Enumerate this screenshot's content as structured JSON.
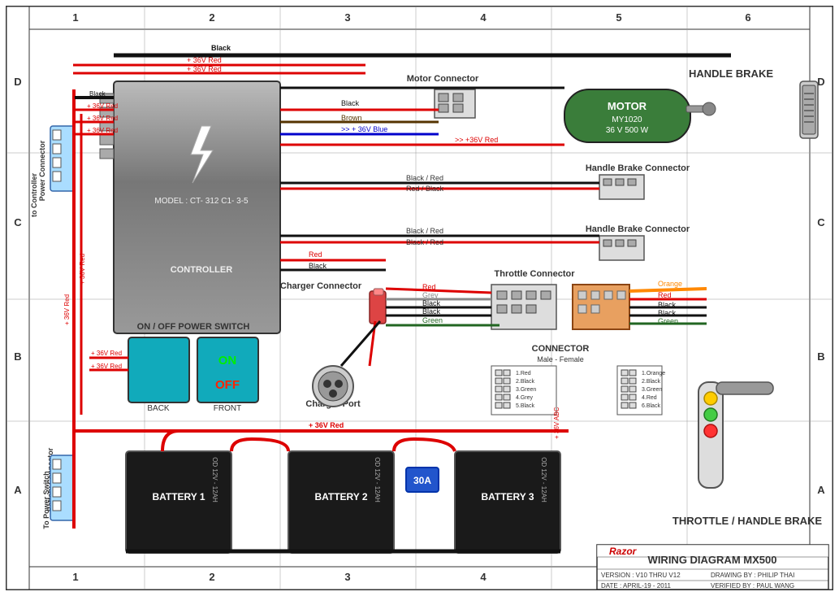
{
  "diagram": {
    "title": "WIRING DIAGRAM MX500",
    "version": "VERSION : V10 THRU V12",
    "drawing_by": "DRAWING BY : PHILIP THAI",
    "date": "DATE : APRIL-19 - 2011",
    "verified_by": "VERIFIED BY : PAUL WANG",
    "brand": "Razor",
    "col_labels": [
      "1",
      "2",
      "3",
      "4",
      "5",
      "6"
    ],
    "row_labels": [
      "D",
      "C",
      "B",
      "A"
    ],
    "components": {
      "motor": {
        "label": "MOTOR",
        "model": "MY1020",
        "spec": "36 V 500 W"
      },
      "controller": {
        "label": "CONTROLLER",
        "model": "MODEL : CT- 312 C1- 3-5"
      },
      "batteries": [
        {
          "label": "BATTERY 1",
          "spec": "OD 12V - 12AH"
        },
        {
          "label": "BATTERY 2",
          "spec": "OD 12V - 12AH"
        },
        {
          "label": "BATTERY 3",
          "spec": "OD 12V - 12AH"
        }
      ],
      "switch": {
        "on_label": "ON",
        "off_label": "OFF",
        "title": "ON / OFF POWER SWITCH",
        "back_label": "BACK",
        "front_label": "FRONT"
      },
      "charger_port_label": "Charger Port",
      "charger_connector_label": "Charger Connector",
      "motor_connector_label": "Motor Connector",
      "handle_brake_connector_label": "Handle Brake Connector",
      "handle_brake_label": "HANDLE BRAKE",
      "throttle_connector_label": "Throttle Connector",
      "throttle_handle_brake_label": "THROTTLE / HANDLE BRAKE",
      "power_connector_label": "Power Connector\nto Controller",
      "battery_connector_label": "Battery Connector\nTo Power Switch",
      "connector_label": "CONNECTOR",
      "connector_sub": "Male - Female"
    },
    "wire_labels": {
      "black": "Black",
      "black_red": "Black / Red",
      "red_black": "Red / Black",
      "brown": "Brown",
      "red": "Red",
      "plus36v_red": "+ 36V Red",
      "plus36v_blue": ">> + 36V Blue",
      "plus36v_red2": ">> +36V Red",
      "minus36v": "+ 36V ABC",
      "grey": "Grey",
      "green": "Green",
      "orange": "Orange"
    },
    "connector_pins": [
      {
        "num": "1",
        "left": "1.Red",
        "right": "1.Orange"
      },
      {
        "num": "2",
        "left": "2.Black",
        "right": "2.Black"
      },
      {
        "num": "3",
        "left": "3.Green",
        "right": "3.Green"
      },
      {
        "num": "4",
        "left": "4.Grey",
        "right": "4.Red"
      },
      {
        "num": "5",
        "left": "5.Black",
        "right": "6.Black"
      }
    ],
    "battery_30a_label": "30A",
    "colors": {
      "red": "#e00",
      "black": "#111",
      "green": "#2a8",
      "blue": "#00a",
      "orange": "#f80",
      "motor_green": "#3a7d3a",
      "controller_grey": "#777",
      "accent": "#1a9"
    }
  }
}
